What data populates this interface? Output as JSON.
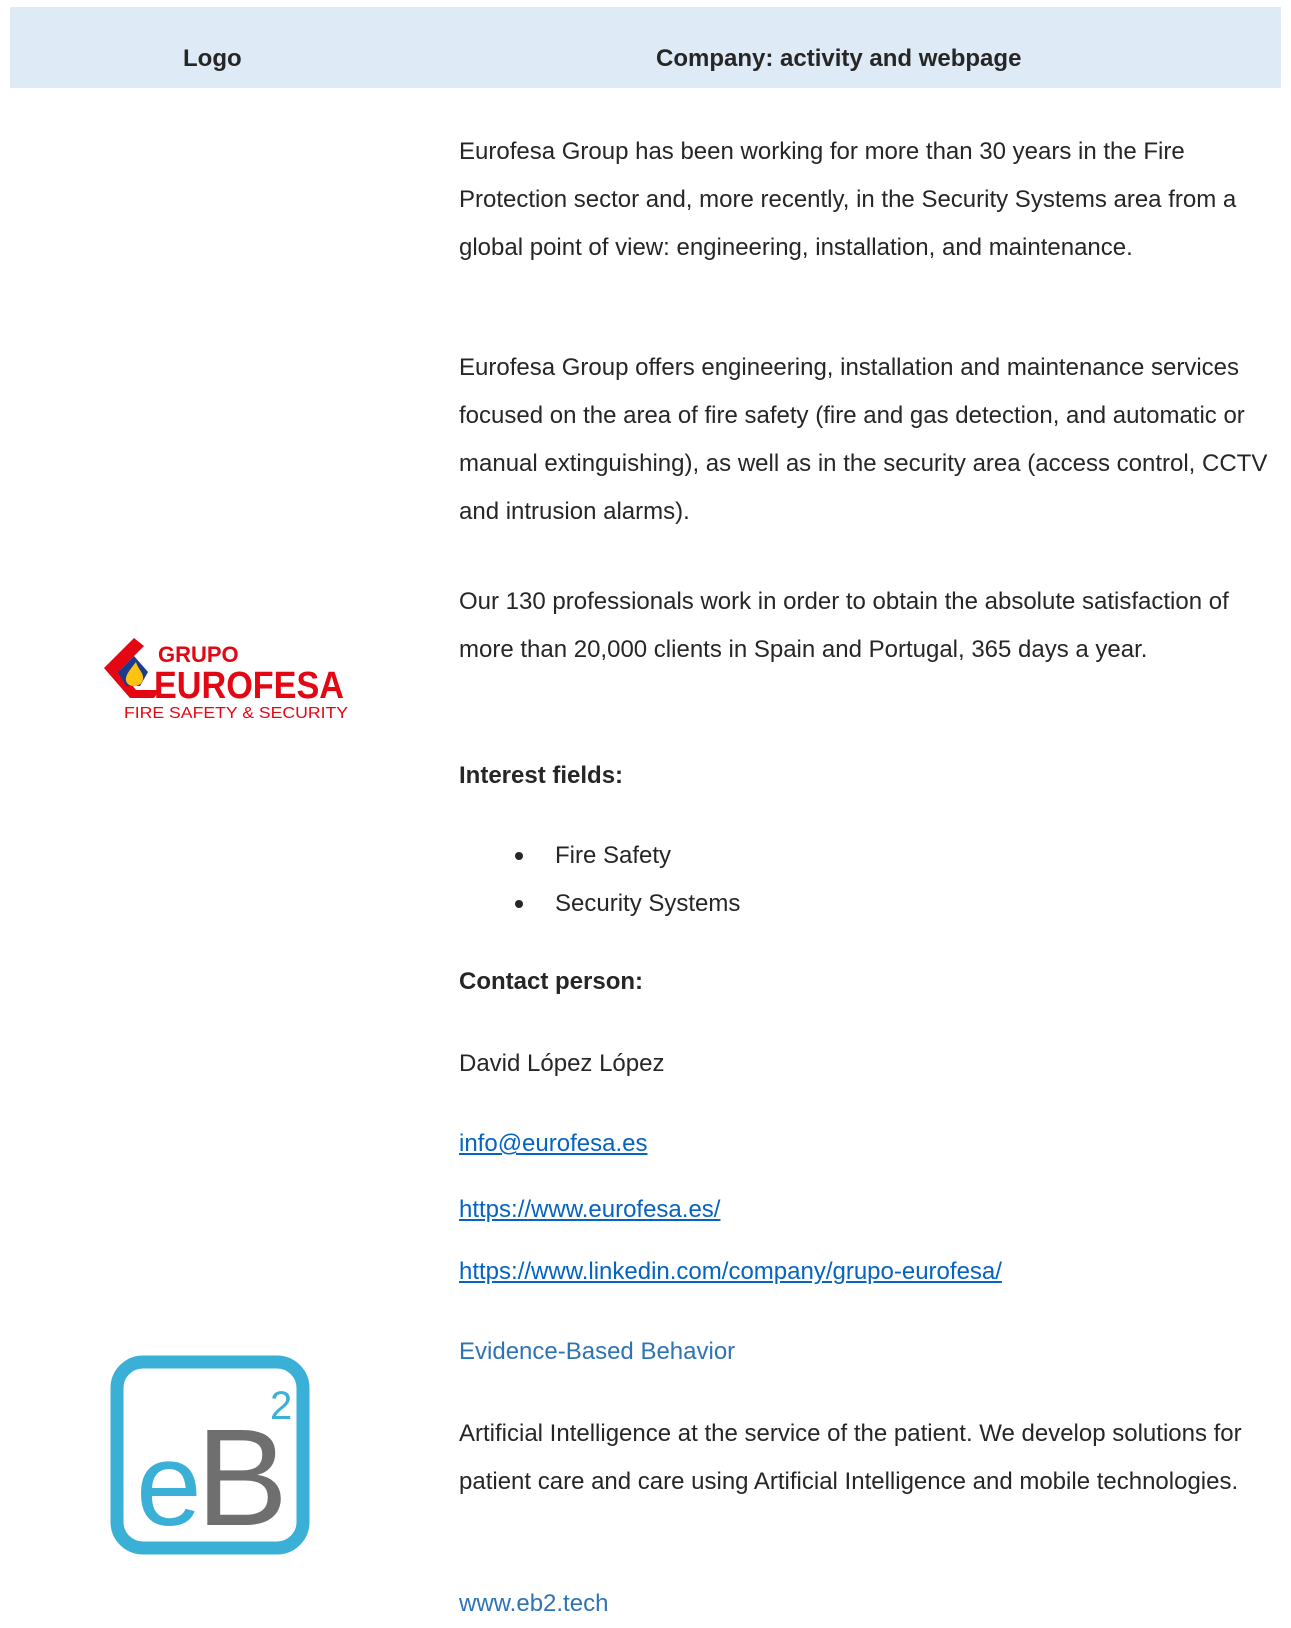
{
  "table": {
    "header": {
      "logo_col": "Logo",
      "company_col": "Company: activity and webpage"
    }
  },
  "eurofesa": {
    "logo": {
      "line1": "GRUPO",
      "line2": "EUROFESA",
      "line3": "FIRE SAFETY & SECURITY",
      "colors": {
        "red": "#e30613",
        "yellow": "#ffc20e",
        "blue": "#1e3a8a"
      }
    },
    "para1": "Eurofesa Group has been working for more than 30 years in the Fire Protection sector and, more recently, in the Security Systems area from a global point of view: engineering, installation, and maintenance.",
    "para2": "Eurofesa Group offers engineering, installation and maintenance services focused on the area of fire safety (fire and gas detection, and automatic or manual extinguishing), as well as in the security area (access control, CCTV and intrusion alarms).",
    "para3": "Our 130 professionals work in order to obtain the absolute satisfaction of more than 20,000 clients in Spain and Portugal, 365 days a year.",
    "interest_label": "Interest fields:",
    "interest_items": [
      "Fire Safety",
      "Security Systems"
    ],
    "contact_label": "Contact person:",
    "contact_name": "David López López",
    "email": "info@eurofesa.es",
    "website": "https://www.eurofesa.es/",
    "linkedin": "https://www.linkedin.com/company/grupo-eurofesa/"
  },
  "eb2": {
    "logo": {
      "letters": "eB",
      "superscript": "2",
      "colors": {
        "teal": "#3ab0d6",
        "gray": "#6f6f6f"
      }
    },
    "name": "Evidence-Based Behavior",
    "description": "Artificial Intelligence at the service of the patient. We develop solutions for patient care and care using Artificial Intelligence and mobile technologies.",
    "website": "www.eb2.tech"
  }
}
